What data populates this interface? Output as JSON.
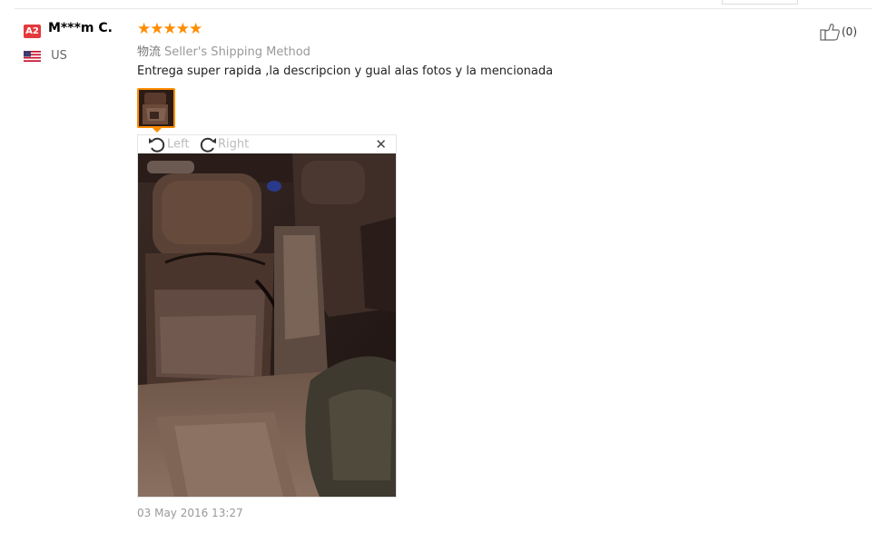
{
  "review": {
    "level_badge": "A2",
    "username": "M***m C.",
    "country_code": "US",
    "rating_stars": "★★★★★",
    "rating": 5,
    "shipping_label": "物流",
    "shipping_value": "Seller's Shipping Method",
    "text": "Entrega super rapida ,la descripcion y gual alas fotos y la mencionada",
    "date": "03 May 2016 13:27",
    "helpful_count": "(0)"
  },
  "viewer": {
    "rotate_left_label": "Left",
    "rotate_right_label": "Right",
    "close_glyph": "✕"
  },
  "icons": {
    "flag": "us-flag-icon",
    "thumbs_up": "thumbs-up-icon",
    "rotate_left": "rotate-left-icon",
    "rotate_right": "rotate-right-icon",
    "close": "close-icon"
  },
  "colors": {
    "star": "#ff8c00",
    "thumb_border": "#ff8c00",
    "badge": "#e4393c"
  }
}
